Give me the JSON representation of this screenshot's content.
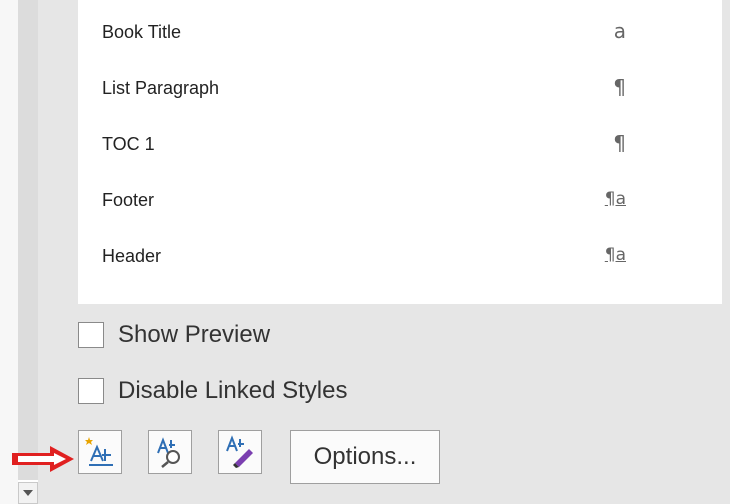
{
  "styles": [
    {
      "name": "Book Title",
      "mark": "a"
    },
    {
      "name": "List Paragraph",
      "mark": "¶"
    },
    {
      "name": "TOC 1",
      "mark": "¶"
    },
    {
      "name": "Footer",
      "mark": "¶a"
    },
    {
      "name": "Header",
      "mark": "¶a"
    },
    {
      "name": "",
      "mark": "¶"
    }
  ],
  "checkboxes": {
    "show_preview": "Show Preview",
    "disable_linked_styles": "Disable Linked Styles"
  },
  "toolbar": {
    "options_label": "Options..."
  },
  "icons": {
    "new_style": "new-style-icon",
    "style_inspector": "style-inspector-icon",
    "manage_styles": "manage-styles-icon",
    "annotation_arrow": "red-arrow-icon",
    "dropdown": "chevron-down-icon"
  },
  "colors": {
    "annotation_arrow": "#e02020",
    "pane_background": "#e6e6e6"
  }
}
